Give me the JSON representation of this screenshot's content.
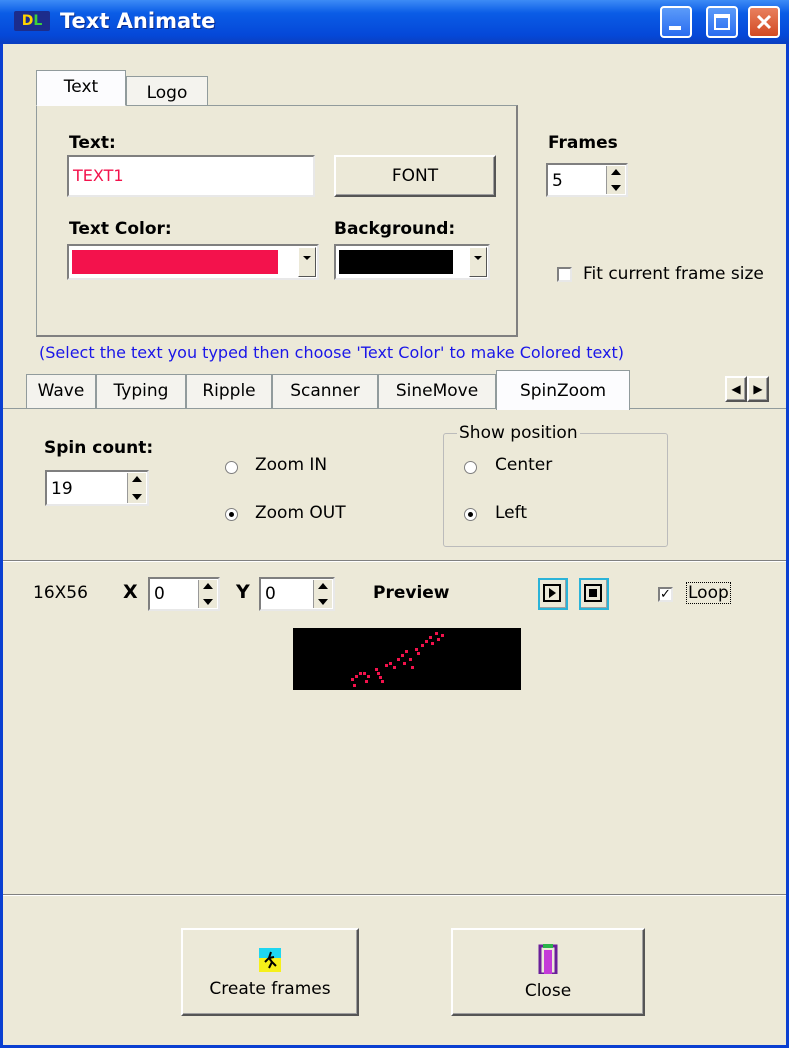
{
  "window": {
    "title": "Text Animate",
    "icon_text": "DL"
  },
  "top_tabs": [
    {
      "label": "Text"
    },
    {
      "label": "Logo"
    }
  ],
  "text_panel": {
    "text_label": "Text:",
    "text_value": "TEXT1",
    "font_button": "FONT",
    "text_color_label": "Text Color:",
    "text_color": "#f3124c",
    "background_label": "Background:",
    "background_color": "#000000"
  },
  "frames": {
    "label": "Frames",
    "value": "5",
    "fit_label": "Fit current frame size",
    "fit_checked": false
  },
  "hint": "(Select the text you typed then choose 'Text Color' to make Colored text)",
  "effect_tabs": [
    {
      "label": "Wave"
    },
    {
      "label": "Typing"
    },
    {
      "label": "Ripple"
    },
    {
      "label": "Scanner"
    },
    {
      "label": "SineMove"
    },
    {
      "label": "SpinZoom",
      "active": true
    }
  ],
  "spinzoom": {
    "spin_count_label": "Spin count:",
    "spin_count_value": "19",
    "zoom_in_label": "Zoom IN",
    "zoom_out_label": "Zoom OUT",
    "zoom_selected": "Zoom OUT",
    "show_position_label": "Show position",
    "center_label": "Center",
    "left_label": "Left",
    "position_selected": "Left"
  },
  "preview": {
    "size_label": "16X56",
    "x_label": "X",
    "x_value": "0",
    "y_label": "Y",
    "y_value": "0",
    "preview_label": "Preview",
    "loop_label": "Loop",
    "loop_checked": true,
    "pixel_color": "#f3124c"
  },
  "buttons": {
    "create_frames": "Create frames",
    "close": "Close"
  }
}
